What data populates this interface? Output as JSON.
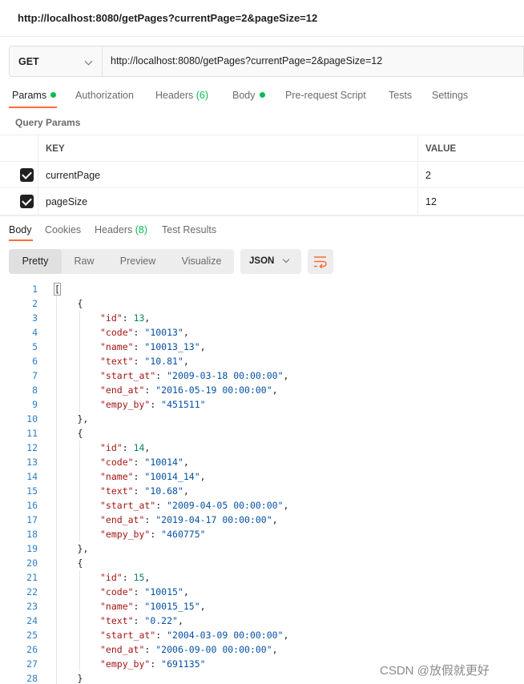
{
  "window": {
    "title": "http://localhost:8080/getPages?currentPage=2&pageSize=12"
  },
  "request": {
    "method": "GET",
    "url": "http://localhost:8080/getPages?currentPage=2&pageSize=12"
  },
  "request_tabs": [
    {
      "label": "Params",
      "dot": true,
      "active": true
    },
    {
      "label": "Authorization"
    },
    {
      "label": "Headers",
      "count": "(6)"
    },
    {
      "label": "Body",
      "dot": true
    },
    {
      "label": "Pre-request Script"
    },
    {
      "label": "Tests"
    },
    {
      "label": "Settings"
    }
  ],
  "query_params": {
    "title": "Query Params",
    "headers": {
      "key": "KEY",
      "value": "VALUE"
    },
    "rows": [
      {
        "checked": true,
        "key": "currentPage",
        "value": "2"
      },
      {
        "checked": true,
        "key": "pageSize",
        "value": "12"
      }
    ]
  },
  "response_tabs": [
    {
      "label": "Body",
      "active": true
    },
    {
      "label": "Cookies"
    },
    {
      "label": "Headers",
      "count": "(8)"
    },
    {
      "label": "Test Results"
    }
  ],
  "view_modes": [
    "Pretty",
    "Raw",
    "Preview",
    "Visualize"
  ],
  "active_view": "Pretty",
  "format": "JSON",
  "icons": {
    "method_dropdown": "chevron-down-icon",
    "format_dropdown": "chevron-down-icon",
    "wrap": "wrap-lines-icon",
    "checkbox": "check-icon"
  },
  "colors": {
    "accent": "#ff6c37",
    "success_dot": "#0cbb52",
    "line_numbers": "#2d7fc6",
    "json_key": "#a31515",
    "json_string": "#0451a5",
    "json_number": "#098658"
  },
  "response_body": [
    {
      "id": 13,
      "code": "10013",
      "name": "10013_13",
      "text": "10.81",
      "start_at": "2009-03-18 00:00:00",
      "end_at": "2016-05-19 00:00:00",
      "empy_by": "451511"
    },
    {
      "id": 14,
      "code": "10014",
      "name": "10014_14",
      "text": "10.68",
      "start_at": "2009-04-05 00:00:00",
      "end_at": "2019-04-17 00:00:00",
      "empy_by": "460775"
    },
    {
      "id": 15,
      "code": "10015",
      "name": "10015_15",
      "text": "0.22",
      "start_at": "2004-03-09 00:00:00",
      "end_at": "2006-09-00 00:00:00",
      "empy_by": "691135"
    }
  ],
  "watermark": "CSDN @放假就更好"
}
